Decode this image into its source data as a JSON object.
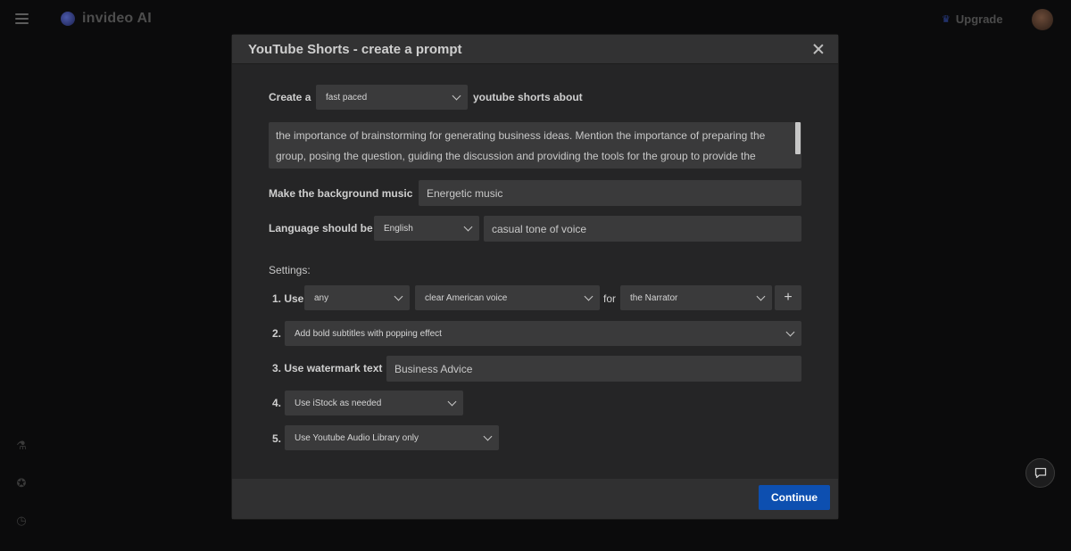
{
  "app": {
    "brand": "invideo AI",
    "upgrade_label": "Upgrade"
  },
  "modal": {
    "title": "YouTube Shorts - create a prompt",
    "create_label": "Create a",
    "pace_select": "fast paced",
    "about_label": "youtube shorts about",
    "topic_text": "the importance of brainstorming for generating business ideas. Mention the importance of preparing the group, posing the question, guiding the discussion and providing the tools for the group to provide the",
    "music_label": "Make the background music",
    "music_value": "Energetic music",
    "language_label": "Language should be",
    "language_select": "English",
    "tone_value": "casual tone of voice",
    "settings_label": "Settings:",
    "setting1_label": "1. Use",
    "setting1_select_a": "any",
    "setting1_select_b": "clear American voice",
    "for_label": "for",
    "setting1_select_c": "the Narrator",
    "setting2_label": "2.",
    "setting2_select": "Add bold subtitles with popping effect",
    "setting3_label": "3. Use watermark text",
    "setting3_value": "Business Advice",
    "setting4_label": "4.",
    "setting4_select": "Use iStock as needed",
    "setting5_label": "5.",
    "setting5_select": "Use Youtube Audio Library only",
    "continue_label": "Continue"
  },
  "icons": {
    "menu": "hamburger-icon",
    "close": "close-icon",
    "chevron": "chevron-down-icon",
    "plus": "plus-icon",
    "chat": "chat-icon"
  },
  "colors": {
    "primary": "#0d4fb0",
    "modal_bg": "#252526",
    "field_bg": "#3a3a3b"
  }
}
